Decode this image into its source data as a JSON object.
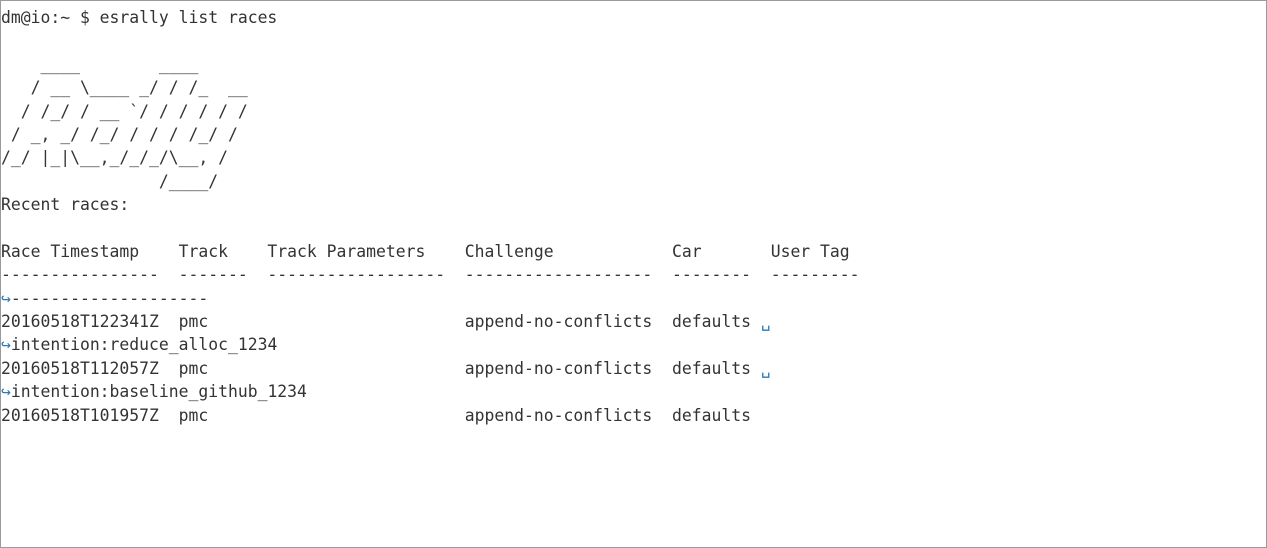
{
  "terminal": {
    "command_line": "dm@io:~ $ esrally list races",
    "banner": [
      "    ____        ____",
      "   / __ \\____ _/ / /_  __",
      "  / /_/ / __ `/ / / / / /",
      " / _, _/ /_/ / / / /_/ /",
      "/_/ |_|\\__,_/_/_/\\__, /",
      "                /____/"
    ],
    "heading": "Recent races:",
    "table_header": "Race Timestamp    Track    Track Parameters    Challenge            Car       User Tag",
    "separator": "----------------  -------  ------------------  -------------------  --------  ---------",
    "separator_cont": "--------------------",
    "rows": [
      {
        "main": "20160518T122341Z  pmc                          append-no-conflicts  defaults ",
        "wrap_marker": "␣",
        "cont": "intention:reduce_alloc_1234"
      },
      {
        "main": "20160518T112057Z  pmc                          append-no-conflicts  defaults ",
        "wrap_marker": "␣",
        "cont": "intention:baseline_github_1234"
      },
      {
        "main": "20160518T101957Z  pmc                          append-no-conflicts  defaults"
      }
    ],
    "continuation_glyph": "↪",
    "colors": {
      "text": "#333333",
      "wrap_marker": "#2a7ab8",
      "border": "#9a9a9a",
      "background": "#ffffff"
    }
  }
}
